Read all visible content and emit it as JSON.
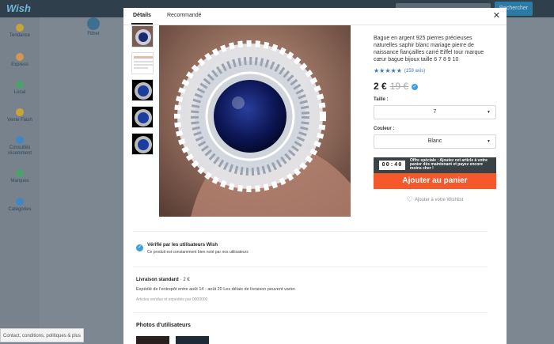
{
  "app": {
    "logo": "Wish"
  },
  "header": {
    "search_button_label": "Rechercher"
  },
  "sidebar": {
    "items": [
      {
        "label": "Tendance",
        "icon": "star-icon",
        "color": "#c9a23a"
      },
      {
        "label": "Express",
        "icon": "box-icon",
        "color": "#d49653"
      },
      {
        "label": "Local",
        "icon": "location-icon",
        "color": "#4aa36b"
      },
      {
        "label": "Vente Flash",
        "icon": "flash-icon",
        "color": "#caa43a"
      },
      {
        "label": "Consultés récemment",
        "icon": "clock-icon",
        "color": "#3f88c5"
      },
      {
        "label": "Marques",
        "icon": "badge-icon",
        "color": "#4aa36b"
      },
      {
        "label": "Catégories",
        "icon": "grid-icon",
        "color": "#3f88c5"
      }
    ],
    "filter_label": "Filtrer"
  },
  "footer": {
    "contact_label": "Contact, conditions, politiques & plus ⌃"
  },
  "modal": {
    "tabs": [
      {
        "label": "Détails",
        "active": true
      },
      {
        "label": "Recommandé",
        "active": false
      }
    ],
    "product": {
      "title": "Bague en argent 925 pierres précieuses naturelles saphir blanc mariage pierre de naissance fiançailles carré Eiffel tour marque cœur bague bijoux taille 6 7 8 9 10",
      "stars": "★★★★★",
      "rating_count": "(159 avis)",
      "price": "2 €",
      "old_price": "19 €",
      "size_label": "Taille :",
      "size_value": "7",
      "color_label": "Couleur :",
      "color_value": "Blanc",
      "timer": "00:40",
      "deal_text": "Offre spéciale : Ajoutez cet article à votre panier dès maintenant et payez encore moins cher !",
      "add_to_cart": "Ajouter au panier",
      "wishlist": "Ajouter à votre Wishlist"
    },
    "verified": {
      "title": "Vérifié par les utilisateurs Wish",
      "subtitle": "Ce produit est constamment bien noté par nos utilisateurs"
    },
    "delivery": {
      "title": "Livraison standard",
      "price": "· 2 €",
      "line": "Expédié de l'entrepôt entre août 14 - août 20 Les délais de livraison peuvent varier.",
      "sold_by": "Articles vendus et expédiés par 0000000"
    },
    "photos_title": "Photos d'utilisateurs"
  },
  "colors": {
    "accent": "#f4582b",
    "brand": "#3f9fdd",
    "timer_bg": "#3b4246"
  }
}
